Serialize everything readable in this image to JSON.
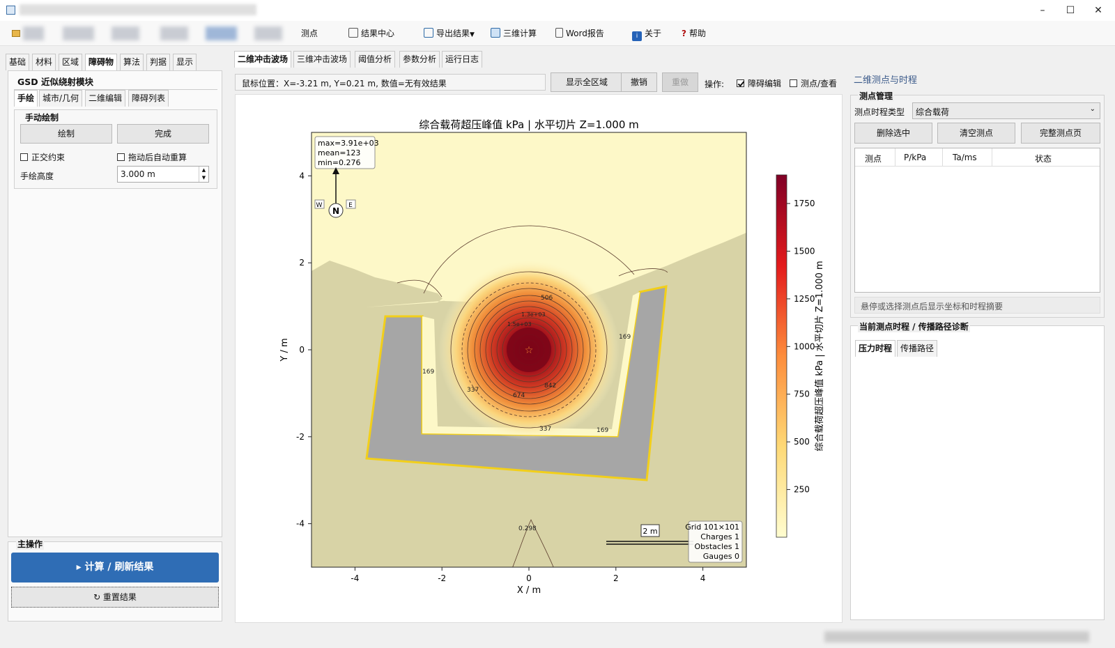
{
  "window": {
    "minimize_icon": "minimize-icon",
    "maximize_icon": "maximize-icon",
    "close_icon": "close-icon"
  },
  "toolbar": {
    "gauges": "测点",
    "result_center": "结果中心",
    "export": "导出结果",
    "three_d": "三维计算",
    "word": "Word报告",
    "about": "关于",
    "help": "帮助"
  },
  "left": {
    "tabs": [
      "基础",
      "材料",
      "区域",
      "障碍物",
      "算法",
      "判据",
      "显示"
    ],
    "module_title": "GSD 近似绕射模块",
    "subtabs": [
      "手绘",
      "城市/几何",
      "二维编辑",
      "障碍列表"
    ],
    "group_title": "手动绘制",
    "draw_btn": "绘制",
    "done_btn": "完成",
    "ortho": "正交约束",
    "auto_recalc": "拖动后自动重算",
    "height_label": "手绘高度",
    "height_value": "3.000 m",
    "main_ops": "主操作",
    "compute_btn": "▸ 计算 / 刷新结果",
    "reset_btn": "↻ 重置结果"
  },
  "center": {
    "tabs": [
      "二维冲击波场",
      "三维冲击波场",
      "阈值分析",
      "参数分析",
      "运行日志"
    ],
    "mouse_pos": "鼠标位置：X=-3.21 m, Y=0.21 m, 数值=无有效结果",
    "show_all": "显示全区域",
    "undo": "撤销",
    "redo": "重做",
    "op_label": "操作:",
    "obstacle_edit": "障碍编辑",
    "gauge_view": "测点/查看"
  },
  "right": {
    "title": "二维测点与时程",
    "gauge_mgmt": "测点管理",
    "type_label": "测点时程类型",
    "type_value": "综合载荷",
    "delete_btn": "删除选中",
    "clear_btn": "清空测点",
    "full_btn": "完整测点页",
    "cols": [
      "测点",
      "P/kPa",
      "Ta/ms",
      "状态"
    ],
    "hint": "悬停或选择测点后显示坐标和时程摘要",
    "diag_title": "当前测点时程 / 传播路径诊断",
    "diag_tabs": [
      "压力时程",
      "传播路径"
    ]
  },
  "chart_data": {
    "type": "heatmap",
    "title": "综合载荷超压峰值 kPa | 水平切片 Z=1.000 m",
    "xlabel": "X / m",
    "ylabel": "Y / m",
    "xlim": [
      -5,
      5
    ],
    "ylim": [
      -5,
      5
    ],
    "xticks": [
      "-4",
      "-2",
      "0",
      "2",
      "4"
    ],
    "yticks": [
      "4",
      "2",
      "0",
      "-2",
      "-4"
    ],
    "colorbar_label": "综合载荷超压峰值 kPa | 水平切片 Z=1.000 m",
    "colorbar_ticks": [
      "1750",
      "1500",
      "1250",
      "1000",
      "750",
      "500",
      "250"
    ],
    "colorbar_range": [
      0,
      1900
    ],
    "charge": {
      "x": 0,
      "y": 0
    },
    "stats": [
      "max=3.91e+03",
      "mean=123",
      "min=0.276"
    ],
    "info": [
      "Grid 101×101",
      "Charges 1",
      "Obstacles 1",
      "Gauges 0"
    ],
    "scale_bar": "2 m",
    "contour_labels": [
      "506",
      "674",
      "842",
      "337",
      "169",
      "169",
      "169",
      "337",
      "0.298",
      "1.5e+03",
      "1.3e+03"
    ],
    "compass": {
      "n": "N",
      "w": "W",
      "e": "E"
    },
    "colors": {
      "low": "#fdf8c8",
      "mid": "#f7b347",
      "high": "#b5121b",
      "dark": "#6b0010",
      "shadow": "#d7d2a8",
      "obstacle": "#a6a6a6",
      "edge": "#f2cf1a"
    }
  }
}
